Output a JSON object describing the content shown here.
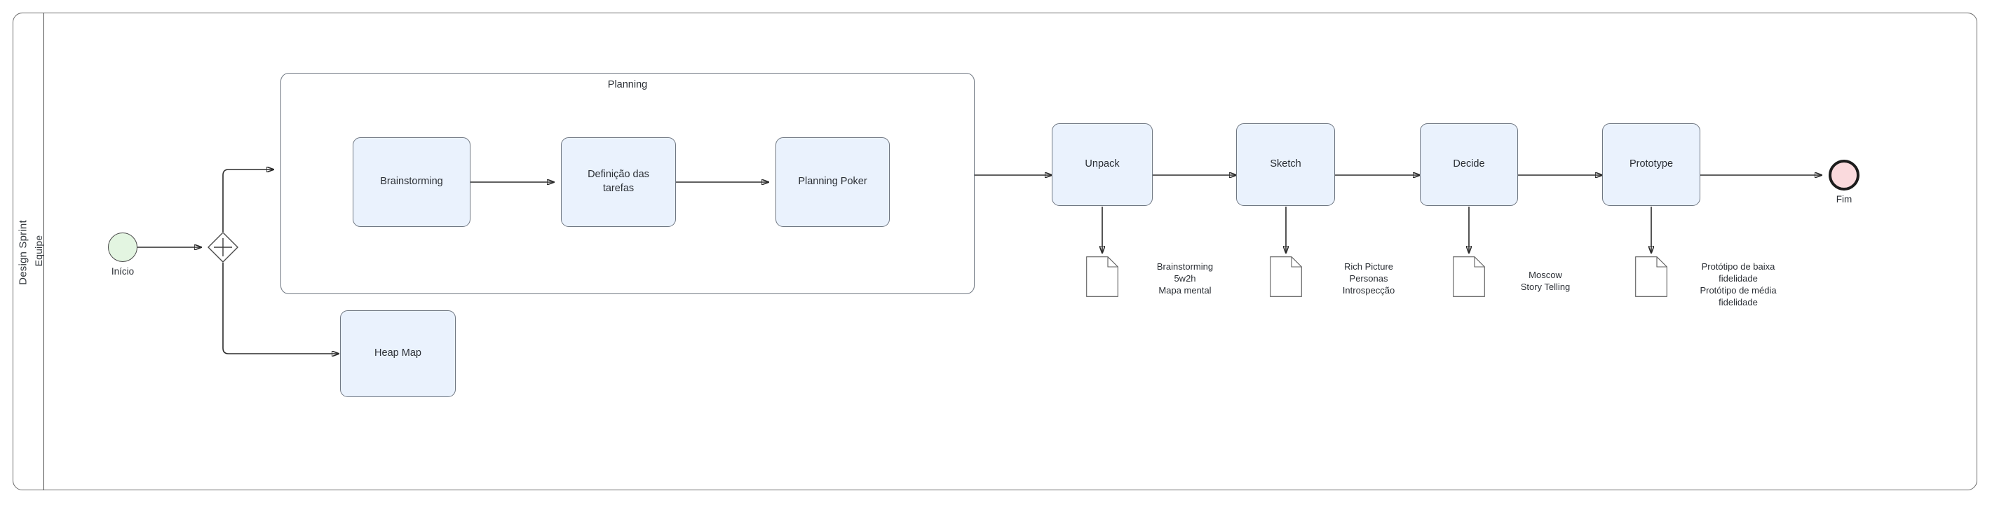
{
  "pool": {
    "name": "Design Sprint",
    "lane": "Equipe"
  },
  "events": {
    "start": {
      "label": "Início",
      "fill": "#e3f5e1"
    },
    "end": {
      "label": "Fim",
      "fill": "#fadadd"
    }
  },
  "gateway": {
    "type": "parallel",
    "symbol": "+"
  },
  "subprocess": {
    "title": "Planning",
    "tasks": [
      {
        "label": "Brainstorming"
      },
      {
        "label": "Definição das\ntarefas"
      },
      {
        "label": "Planning Poker"
      }
    ]
  },
  "branch_task": {
    "label": "Heap Map"
  },
  "main_tasks": [
    {
      "label": "Unpack",
      "artifact": "Brainstorming\n5w2h\nMapa mental"
    },
    {
      "label": "Sketch",
      "artifact": "Rich Picture\nPersonas\nIntrospecção"
    },
    {
      "label": "Decide",
      "artifact": "Moscow\nStory Telling"
    },
    {
      "label": "Prototype",
      "artifact": "Protótipo de baixa\nfidelidade\nProtótipo de média\nfidelidade"
    }
  ],
  "colors": {
    "task_fill": "#eaf2fd",
    "task_stroke": "#6f7782",
    "connector": "#2b2b2b",
    "pool_stroke": "#6b6b6b"
  }
}
